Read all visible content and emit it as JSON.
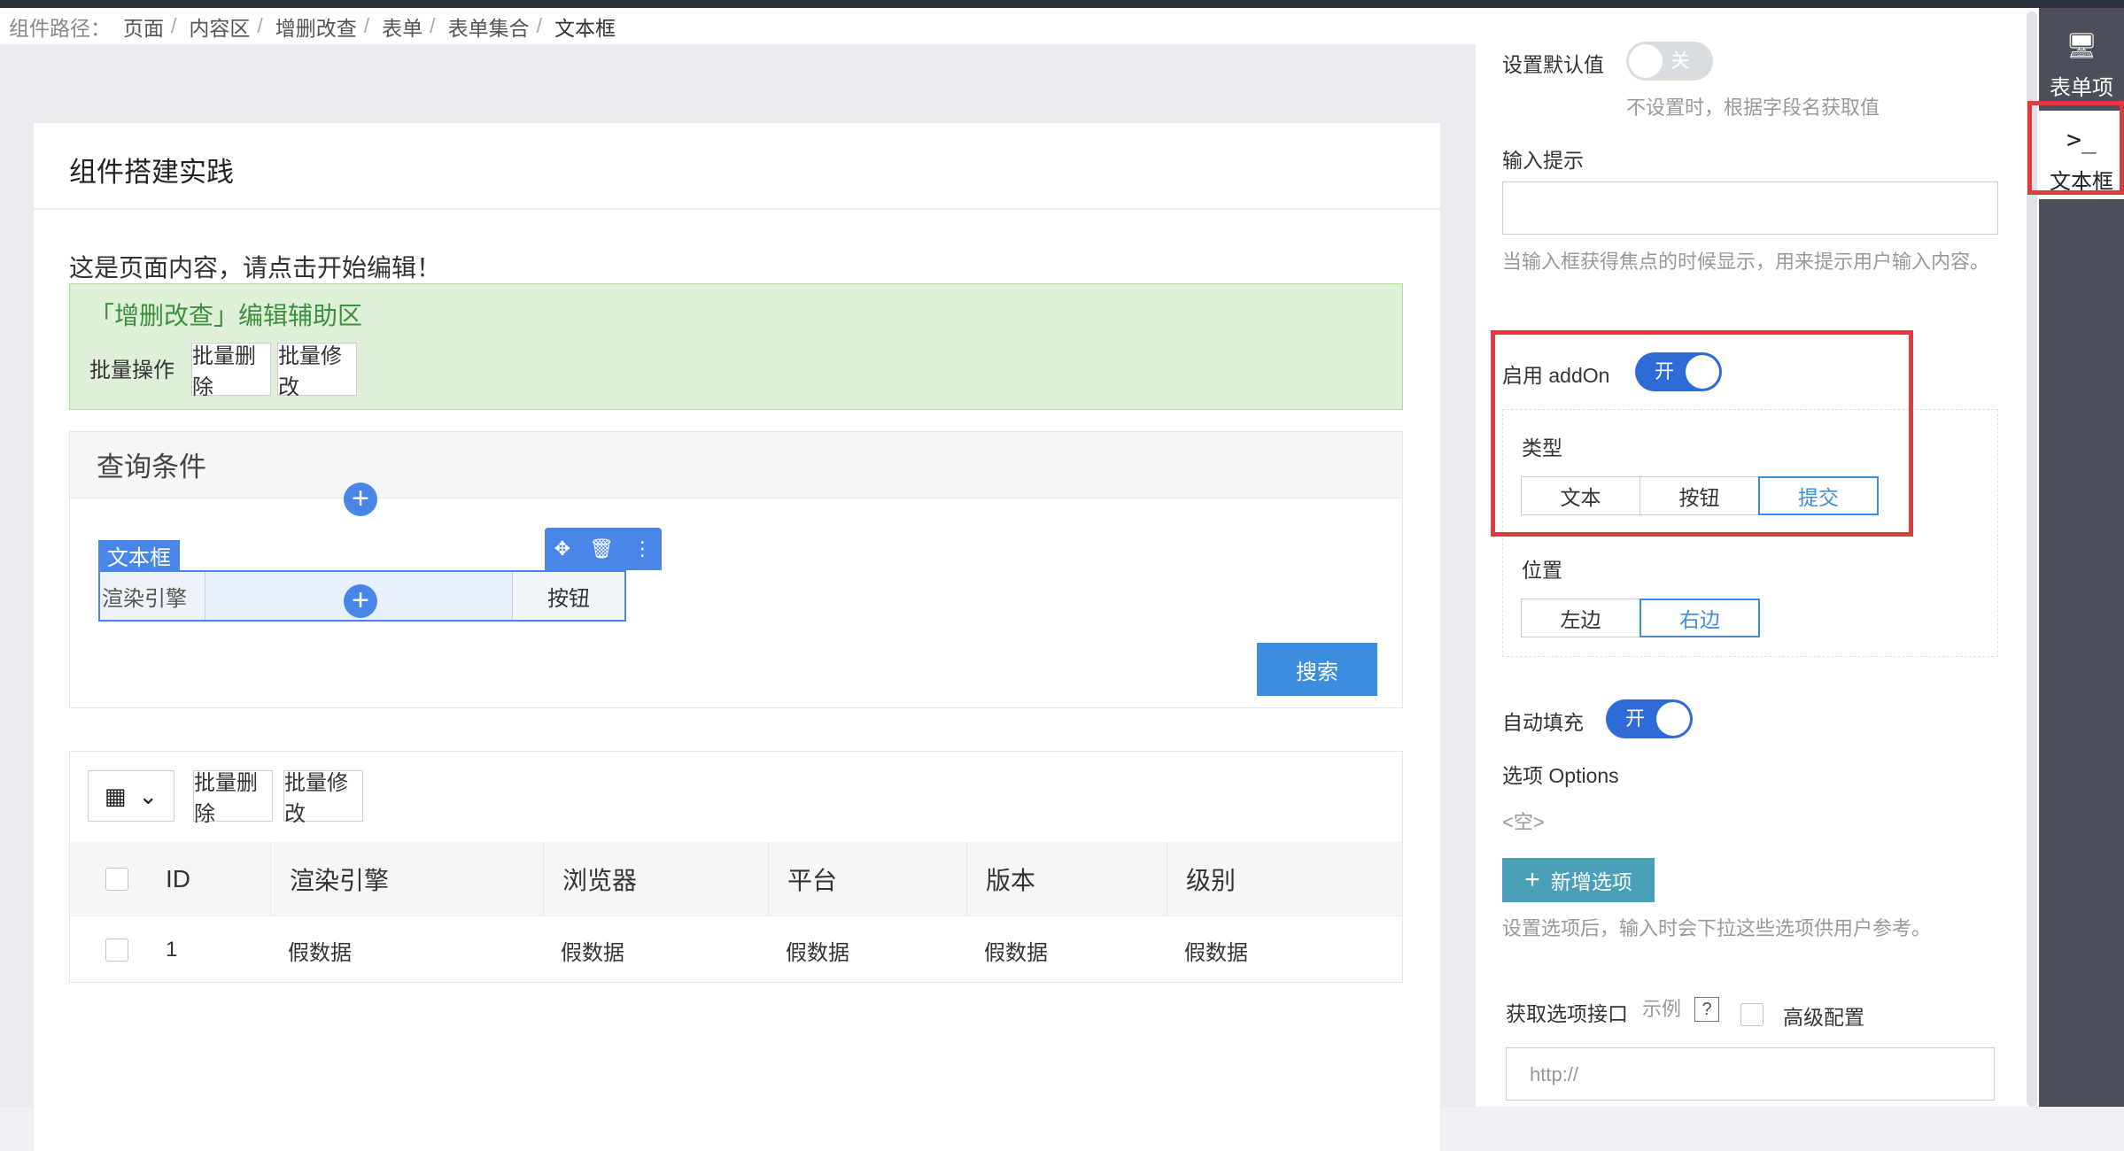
{
  "breadcrumb": {
    "label": "组件路径：",
    "items": [
      "页面",
      "内容区",
      "增删改查",
      "表单",
      "表单集合"
    ],
    "current": "文本框"
  },
  "page": {
    "title": "组件搭建实践",
    "intro": "这是页面内容，请点击开始编辑！"
  },
  "assist": {
    "title": "「增删改查」编辑辅助区",
    "ops_label": "批量操作",
    "batch_delete": "批量删除",
    "batch_edit": "批量修改"
  },
  "query": {
    "title": "查询条件",
    "tag": "文本框",
    "field_label": "渲染引擎",
    "field_button": "按钮",
    "search": "搜索"
  },
  "table": {
    "batch_delete": "批量删除",
    "batch_edit": "批量修改",
    "columns": [
      "ID",
      "渲染引擎",
      "浏览器",
      "平台",
      "版本",
      "级别"
    ],
    "rows": [
      [
        "1",
        "假数据",
        "假数据",
        "假数据",
        "假数据",
        "假数据"
      ]
    ]
  },
  "panel": {
    "default_label": "设置默认值",
    "default_switch": "关",
    "default_hint": "不设置时，根据字段名获取值",
    "placeholder_label": "输入提示",
    "placeholder_hint": "当输入框获得焦点的时候显示，用来提示用户输入内容。",
    "addon_label": "启用 addOn",
    "addon_switch": "开",
    "type_label": "类型",
    "type_options": [
      "文本",
      "按钮",
      "提交"
    ],
    "type_selected": "提交",
    "position_label": "位置",
    "position_options": [
      "左边",
      "右边"
    ],
    "position_selected": "右边",
    "autofill_label": "自动填充",
    "autofill_switch": "开",
    "options_label": "选项 Options",
    "options_empty": "<空>",
    "add_option": "新增选项",
    "options_hint": "设置选项后，输入时会下拉这些选项供用户参考。",
    "api_label": "获取选项接口",
    "api_example": "示例",
    "api_help": "?",
    "advanced_label": "高级配置",
    "api_placeholder": "http://"
  },
  "rail": {
    "items": [
      {
        "label": "表单项",
        "icon": "monitor-icon"
      },
      {
        "label": "文本框",
        "icon": "terminal-icon"
      }
    ]
  },
  "colors": {
    "primary": "#3b8de0",
    "switch_on": "#2f6bd8",
    "highlight_box": "#e03a3a",
    "assist_bg": "#dff0d8",
    "add_button": "#4aa0b8"
  }
}
